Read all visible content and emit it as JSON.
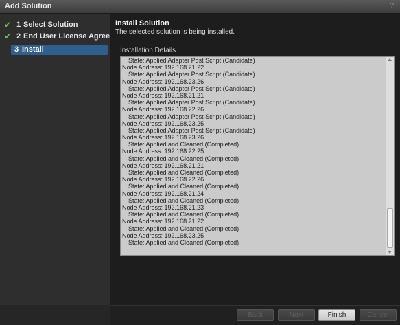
{
  "window": {
    "title": "Add Solution",
    "help": "?"
  },
  "steps": [
    {
      "number": "1",
      "label": "Select Solution",
      "status": "completed"
    },
    {
      "number": "2",
      "label": "End User License Agreement",
      "status": "completed"
    },
    {
      "number": "3",
      "label": "Install",
      "status": "active"
    }
  ],
  "main": {
    "heading": "Install Solution",
    "subtext": "The selected solution is being installed.",
    "details_label": "Installation Details"
  },
  "log_lines": [
    "State: Applied Adapter Post Script (Candidate)",
    "Node Address: 192.168.21.22",
    "State: Applied Adapter Post Script (Candidate)",
    "Node Address: 192.168.23.26",
    "State: Applied Adapter Post Script (Candidate)",
    "Node Address: 192.168.21.21",
    "State: Applied Adapter Post Script (Candidate)",
    "Node Address: 192.168.22.26",
    "State: Applied Adapter Post Script (Candidate)",
    "Node Address: 192.168.23.25",
    "State: Applied Adapter Post Script (Candidate)",
    "Node Address: 192.168.23.26",
    "State: Applied and Cleaned (Completed)",
    "Node Address: 192.168.22.25",
    "State: Applied and Cleaned (Completed)",
    "Node Address: 192.168.21.21",
    "State: Applied and Cleaned (Completed)",
    "Node Address: 192.168.22.26",
    "State: Applied and Cleaned (Completed)",
    "Node Address: 192.168.21.24",
    "State: Applied and Cleaned (Completed)",
    "Node Address: 192.168.21.23",
    "State: Applied and Cleaned (Completed)",
    "Node Address: 192.168.21.22",
    "State: Applied and Cleaned (Completed)",
    "Node Address: 192.168.23.25",
    "State: Applied and Cleaned (Completed)"
  ],
  "buttons": {
    "back": "Back",
    "next": "Next",
    "finish": "Finish",
    "cancel": "Cancel"
  },
  "colors": {
    "accent_selected": "#2f5f8f",
    "check": "#6fc24a",
    "log_background": "#cbcbcb"
  }
}
